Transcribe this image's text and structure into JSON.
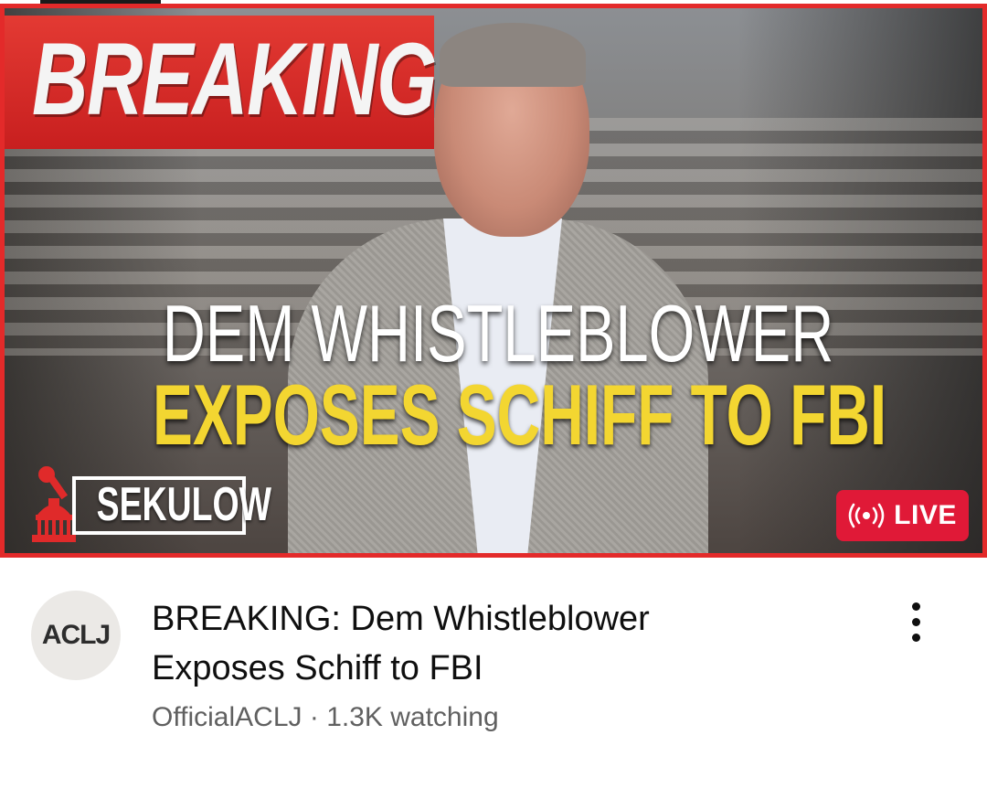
{
  "video": {
    "thumbnail": {
      "breaking_label": "BREAKING",
      "headline_line1": "DEM WHISTLEBLOWER",
      "headline_line2": "EXPOSES SCHIFF TO FBI",
      "brand_logo_text": "SEKULOW",
      "live_badge": "LIVE",
      "live_badge_icon": "broadcast-icon",
      "colors": {
        "border": "#e32a2a",
        "breaking_band": "#d42626",
        "headline_highlight": "#f3d631",
        "live_badge": "#e01937"
      }
    },
    "channel_avatar_text": "ACLJ",
    "title_line1": "BREAKING: Dem Whistleblower",
    "title_line2": "Exposes Schiff to FBI",
    "channel_name": "OfficialACLJ",
    "separator": " · ",
    "watching": "1.3K watching",
    "more_icon": "more-vert-icon"
  }
}
